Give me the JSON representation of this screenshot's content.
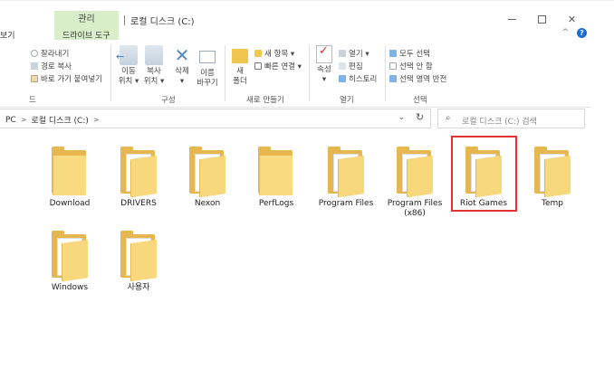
{
  "titlebar": {
    "manage_tab": "관리",
    "title": "로컬 디스크 (C:)",
    "minimize": "minimize-icon",
    "maximize": "maximize-icon",
    "close": "✕"
  },
  "ribbon_tabs": {
    "view": "보기",
    "drive_tools": "드라이브 도구",
    "collapse": "^",
    "help": "?"
  },
  "ribbon": {
    "clipboard": {
      "cut": "잘라내기",
      "copy_path": "경로 복사",
      "paste_shortcut": "바로 가기 붙여넣기",
      "label": "드"
    },
    "organize": {
      "move_to": "이동\n위치 ▾",
      "copy_to": "복사\n위치 ▾",
      "delete": "삭제\n▾",
      "rename": "이름\n바꾸기",
      "label": "구성"
    },
    "new": {
      "new_folder": "새\n폴더",
      "new_item": "새 항목 ▾",
      "easy_access": "빠른 연결 ▾",
      "label": "새로 만들기"
    },
    "open": {
      "properties": "속성\n▾",
      "open": "열기 ▾",
      "edit": "편집",
      "history": "히스토리",
      "label": "열기"
    },
    "select": {
      "select_all": "모두 선택",
      "select_none": "선택 안 함",
      "invert": "선택 영역 반전",
      "label": "선택"
    }
  },
  "address": {
    "pc": "PC",
    "drive": "로컬 디스크 (C:)",
    "sep": ">",
    "dropdown": "⌄",
    "refresh": "↻"
  },
  "search": {
    "placeholder": "로컬 디스크 (C:) 검색",
    "icon": "search-icon"
  },
  "folders": [
    {
      "name": "Download",
      "type": "empty"
    },
    {
      "name": "DRIVERS",
      "type": "full"
    },
    {
      "name": "Nexon",
      "type": "full"
    },
    {
      "name": "PerfLogs",
      "type": "empty"
    },
    {
      "name": "Program Files",
      "type": "full"
    },
    {
      "name": "Program Files\n(x86)",
      "type": "full"
    },
    {
      "name": "Riot Games",
      "type": "full",
      "selected": true
    },
    {
      "name": "Temp",
      "type": "full"
    },
    {
      "name": "Windows",
      "type": "full"
    },
    {
      "name": "사용자",
      "type": "full"
    }
  ],
  "colors": {
    "manage_tab": "#d8eec8",
    "folder": "#f7d87c",
    "highlight": "#e23232",
    "help": "#1a6fd6"
  }
}
